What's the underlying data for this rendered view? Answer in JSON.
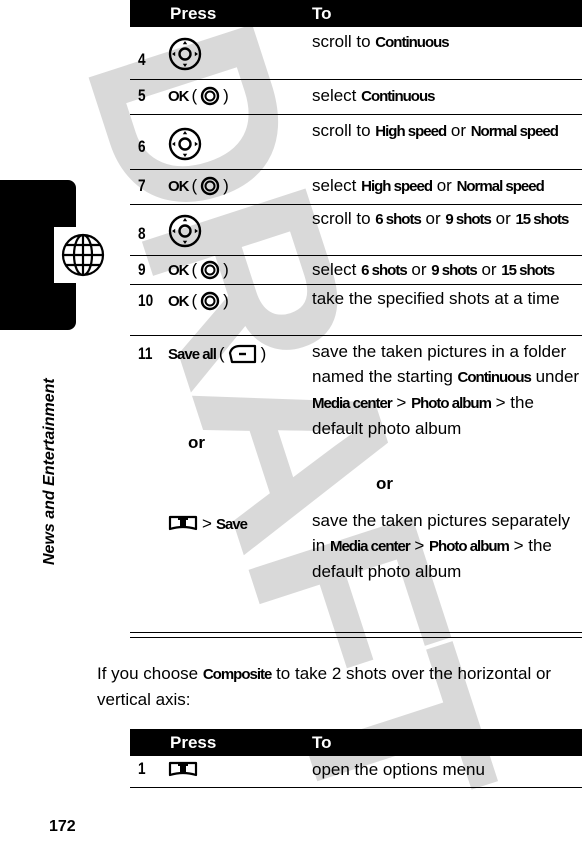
{
  "watermark": "DRAFT",
  "side_tab": {
    "icon": "globe-icon",
    "label": "News and Entertainment"
  },
  "page_number": "172",
  "table1": {
    "headers": {
      "press": "Press",
      "to": "To"
    },
    "rows": [
      {
        "num": "4",
        "press_icon": "nav-key-icon",
        "to": [
          [
            "scroll to ",
            false
          ],
          [
            "Continuous",
            true
          ]
        ]
      },
      {
        "num": "5",
        "press_label": "OK",
        "press_icon": "center-select-icon",
        "to": [
          [
            "select ",
            false
          ],
          [
            "Continuous",
            true
          ]
        ]
      },
      {
        "num": "6",
        "press_icon": "nav-key-icon",
        "to": [
          [
            "scroll to ",
            false
          ],
          [
            "High speed",
            true
          ],
          [
            " or ",
            false
          ],
          [
            "Normal speed",
            true
          ]
        ]
      },
      {
        "num": "7",
        "press_label": "OK",
        "press_icon": "center-select-icon",
        "to": [
          [
            "select ",
            false
          ],
          [
            "High speed",
            true
          ],
          [
            " or ",
            false
          ],
          [
            "Normal speed",
            true
          ]
        ]
      },
      {
        "num": "8",
        "press_icon": "nav-key-icon",
        "to": [
          [
            "scroll to ",
            false
          ],
          [
            "6 shots",
            true
          ],
          [
            " or ",
            false
          ],
          [
            "9 shots",
            true
          ],
          [
            " or ",
            false
          ],
          [
            "15 shots",
            true
          ]
        ]
      },
      {
        "num": "9",
        "press_label": "OK",
        "press_icon": "center-select-icon",
        "to": [
          [
            "select ",
            false
          ],
          [
            "6 shots",
            true
          ],
          [
            " or ",
            false
          ],
          [
            "9 shots",
            true
          ],
          [
            " or ",
            false
          ],
          [
            "15 shots",
            true
          ]
        ]
      },
      {
        "num": "10",
        "press_label": "OK",
        "press_icon": "center-select-icon",
        "to": [
          [
            "take the specified shots at a time",
            false
          ]
        ]
      },
      {
        "num": "11",
        "press_label": "Save all",
        "press_icon": "left-soft-key-icon",
        "to": [
          [
            "save the taken pictures in a folder named the starting ",
            false
          ],
          [
            "Continuous",
            true
          ],
          [
            " under ",
            false
          ],
          [
            "Media center",
            true
          ],
          [
            " > ",
            false
          ],
          [
            "Photo album",
            true
          ],
          [
            " > the default photo album",
            false
          ]
        ],
        "or_label": "or",
        "alt_press_icon": "menu-key-icon",
        "alt_press_label": "Save",
        "alt_to": [
          [
            "save the taken pictures separately in ",
            false
          ],
          [
            "Media center",
            true
          ],
          [
            " > ",
            false
          ],
          [
            "Photo album",
            true
          ],
          [
            " > the default photo album",
            false
          ]
        ]
      }
    ]
  },
  "paragraph": [
    [
      "If you choose ",
      false
    ],
    [
      "Composite",
      true
    ],
    [
      " to take 2 shots over the horizontal or vertical axis:",
      false
    ]
  ],
  "table2": {
    "headers": {
      "press": "Press",
      "to": "To"
    },
    "rows": [
      {
        "num": "1",
        "press_icon": "menu-key-icon",
        "to": [
          [
            "open the options menu",
            false
          ]
        ]
      }
    ]
  }
}
